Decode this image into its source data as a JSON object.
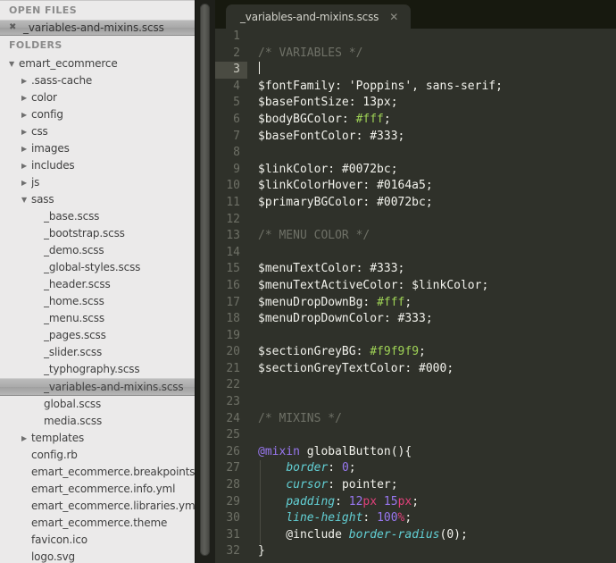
{
  "sidebar": {
    "open_files_heading": "OPEN FILES",
    "open_file": {
      "name": "_variables-and-mixins.scss",
      "close_glyph": "✖"
    },
    "folders_heading": "FOLDERS",
    "tree": [
      {
        "label": "emart_ecommerce",
        "level": 0,
        "arrow": "▼",
        "type": "folder",
        "selected": false
      },
      {
        "label": ".sass-cache",
        "level": 1,
        "arrow": "▶",
        "type": "folder",
        "selected": false
      },
      {
        "label": "color",
        "level": 1,
        "arrow": "▶",
        "type": "folder",
        "selected": false
      },
      {
        "label": "config",
        "level": 1,
        "arrow": "▶",
        "type": "folder",
        "selected": false
      },
      {
        "label": "css",
        "level": 1,
        "arrow": "▶",
        "type": "folder",
        "selected": false
      },
      {
        "label": "images",
        "level": 1,
        "arrow": "▶",
        "type": "folder",
        "selected": false
      },
      {
        "label": "includes",
        "level": 1,
        "arrow": "▶",
        "type": "folder",
        "selected": false
      },
      {
        "label": "js",
        "level": 1,
        "arrow": "▶",
        "type": "folder",
        "selected": false
      },
      {
        "label": "sass",
        "level": 1,
        "arrow": "▼",
        "type": "folder",
        "selected": false
      },
      {
        "label": "_base.scss",
        "level": 2,
        "arrow": "",
        "type": "file",
        "selected": false
      },
      {
        "label": "_bootstrap.scss",
        "level": 2,
        "arrow": "",
        "type": "file",
        "selected": false
      },
      {
        "label": "_demo.scss",
        "level": 2,
        "arrow": "",
        "type": "file",
        "selected": false
      },
      {
        "label": "_global-styles.scss",
        "level": 2,
        "arrow": "",
        "type": "file",
        "selected": false
      },
      {
        "label": "_header.scss",
        "level": 2,
        "arrow": "",
        "type": "file",
        "selected": false
      },
      {
        "label": "_home.scss",
        "level": 2,
        "arrow": "",
        "type": "file",
        "selected": false
      },
      {
        "label": "_menu.scss",
        "level": 2,
        "arrow": "",
        "type": "file",
        "selected": false
      },
      {
        "label": "_pages.scss",
        "level": 2,
        "arrow": "",
        "type": "file",
        "selected": false
      },
      {
        "label": "_slider.scss",
        "level": 2,
        "arrow": "",
        "type": "file",
        "selected": false
      },
      {
        "label": "_typhography.scss",
        "level": 2,
        "arrow": "",
        "type": "file",
        "selected": false
      },
      {
        "label": "_variables-and-mixins.scss",
        "level": 2,
        "arrow": "",
        "type": "file",
        "selected": true
      },
      {
        "label": "global.scss",
        "level": 2,
        "arrow": "",
        "type": "file",
        "selected": false
      },
      {
        "label": "media.scss",
        "level": 2,
        "arrow": "",
        "type": "file",
        "selected": false
      },
      {
        "label": "templates",
        "level": 1,
        "arrow": "▶",
        "type": "folder",
        "selected": false
      },
      {
        "label": "config.rb",
        "level": 1,
        "arrow": "",
        "type": "file",
        "selected": false
      },
      {
        "label": "emart_ecommerce.breakpoints.yml",
        "level": 1,
        "arrow": "",
        "type": "file",
        "selected": false
      },
      {
        "label": "emart_ecommerce.info.yml",
        "level": 1,
        "arrow": "",
        "type": "file",
        "selected": false
      },
      {
        "label": "emart_ecommerce.libraries.yml",
        "level": 1,
        "arrow": "",
        "type": "file",
        "selected": false
      },
      {
        "label": "emart_ecommerce.theme",
        "level": 1,
        "arrow": "",
        "type": "file",
        "selected": false
      },
      {
        "label": "favicon.ico",
        "level": 1,
        "arrow": "",
        "type": "file",
        "selected": false
      },
      {
        "label": "logo.svg",
        "level": 1,
        "arrow": "",
        "type": "file",
        "selected": false
      }
    ]
  },
  "editor": {
    "tab": {
      "title": "_variables-and-mixins.scss",
      "close_glyph": "✕"
    },
    "cursor_line": 3,
    "colors": {
      "background": "#2f312a",
      "tabbar_background": "#17190f",
      "gutter_text": "#6e7066",
      "active_gutter": "#4a4b42",
      "comment": "#6f7167",
      "string_green": "#9fd356",
      "property_cyan": "#62cfd4",
      "number_purple": "#9877f0",
      "unit_pink": "#e0407a",
      "plain_text": "#f2f2ec"
    },
    "lines": [
      {
        "n": 1,
        "tokens": []
      },
      {
        "n": 2,
        "tokens": [
          {
            "t": "/* VARIABLES */",
            "c": "comment"
          }
        ]
      },
      {
        "n": 3,
        "tokens": [],
        "caret": true
      },
      {
        "n": 4,
        "tokens": [
          {
            "t": "$fontFamily: 'Poppins', sans-serif;",
            "c": "plain"
          }
        ]
      },
      {
        "n": 5,
        "tokens": [
          {
            "t": "$baseFontSize: 13px;",
            "c": "plain"
          }
        ]
      },
      {
        "n": 6,
        "tokens": [
          {
            "t": "$bodyBGColor: ",
            "c": "plain"
          },
          {
            "t": "#fff",
            "c": "green"
          },
          {
            "t": ";",
            "c": "plain"
          }
        ]
      },
      {
        "n": 7,
        "tokens": [
          {
            "t": "$baseFontColor: #333;",
            "c": "plain"
          }
        ]
      },
      {
        "n": 8,
        "tokens": []
      },
      {
        "n": 9,
        "tokens": [
          {
            "t": "$linkColor: #0072bc;",
            "c": "plain"
          }
        ]
      },
      {
        "n": 10,
        "tokens": [
          {
            "t": "$linkColorHover: #0164a5;",
            "c": "plain"
          }
        ]
      },
      {
        "n": 11,
        "tokens": [
          {
            "t": "$primaryBGColor: #0072bc;",
            "c": "plain"
          }
        ]
      },
      {
        "n": 12,
        "tokens": []
      },
      {
        "n": 13,
        "tokens": [
          {
            "t": "/* MENU COLOR */",
            "c": "comment"
          }
        ]
      },
      {
        "n": 14,
        "tokens": []
      },
      {
        "n": 15,
        "tokens": [
          {
            "t": "$menuTextColor: #333;",
            "c": "plain"
          }
        ]
      },
      {
        "n": 16,
        "tokens": [
          {
            "t": "$menuTextActiveColor: $linkColor;",
            "c": "plain"
          }
        ]
      },
      {
        "n": 17,
        "tokens": [
          {
            "t": "$menuDropDownBg: ",
            "c": "plain"
          },
          {
            "t": "#fff",
            "c": "green"
          },
          {
            "t": ";",
            "c": "plain"
          }
        ]
      },
      {
        "n": 18,
        "tokens": [
          {
            "t": "$menuDropDownColor: #333;",
            "c": "plain"
          }
        ]
      },
      {
        "n": 19,
        "tokens": []
      },
      {
        "n": 20,
        "tokens": [
          {
            "t": "$sectionGreyBG: ",
            "c": "plain"
          },
          {
            "t": "#f9f9f9",
            "c": "green"
          },
          {
            "t": ";",
            "c": "plain"
          }
        ]
      },
      {
        "n": 21,
        "tokens": [
          {
            "t": "$sectionGreyTextColor: #000;",
            "c": "plain"
          }
        ]
      },
      {
        "n": 22,
        "tokens": []
      },
      {
        "n": 23,
        "tokens": []
      },
      {
        "n": 24,
        "tokens": [
          {
            "t": "/* MIXINS */",
            "c": "comment"
          }
        ]
      },
      {
        "n": 25,
        "tokens": []
      },
      {
        "n": 26,
        "tokens": [
          {
            "t": "@mixin",
            "c": "at"
          },
          {
            "t": " globalButton(){",
            "c": "plain"
          }
        ]
      },
      {
        "n": 27,
        "tokens": [
          {
            "t": "    ",
            "c": "plain"
          },
          {
            "t": "border",
            "c": "cyan"
          },
          {
            "t": ": ",
            "c": "plain"
          },
          {
            "t": "0",
            "c": "purple"
          },
          {
            "t": ";",
            "c": "plain"
          }
        ],
        "guide": true
      },
      {
        "n": 28,
        "tokens": [
          {
            "t": "    ",
            "c": "plain"
          },
          {
            "t": "cursor",
            "c": "cyan"
          },
          {
            "t": ": ",
            "c": "plain"
          },
          {
            "t": "pointer",
            "c": "plain"
          },
          {
            "t": ";",
            "c": "plain"
          }
        ],
        "guide": true
      },
      {
        "n": 29,
        "tokens": [
          {
            "t": "    ",
            "c": "plain"
          },
          {
            "t": "padding",
            "c": "cyan"
          },
          {
            "t": ": ",
            "c": "plain"
          },
          {
            "t": "12",
            "c": "purple"
          },
          {
            "t": "px",
            "c": "pink"
          },
          {
            "t": " ",
            "c": "plain"
          },
          {
            "t": "15",
            "c": "purple"
          },
          {
            "t": "px",
            "c": "pink"
          },
          {
            "t": ";",
            "c": "plain"
          }
        ],
        "guide": true
      },
      {
        "n": 30,
        "tokens": [
          {
            "t": "    ",
            "c": "plain"
          },
          {
            "t": "line-height",
            "c": "cyan"
          },
          {
            "t": ": ",
            "c": "plain"
          },
          {
            "t": "100",
            "c": "purple"
          },
          {
            "t": "%",
            "c": "pink"
          },
          {
            "t": ";",
            "c": "plain"
          }
        ],
        "guide": true
      },
      {
        "n": 31,
        "tokens": [
          {
            "t": "    @include ",
            "c": "plain"
          },
          {
            "t": "border-radius",
            "c": "cyan"
          },
          {
            "t": "(0);",
            "c": "plain"
          }
        ],
        "guide": true
      },
      {
        "n": 32,
        "tokens": [
          {
            "t": "}",
            "c": "plain"
          }
        ]
      }
    ]
  }
}
